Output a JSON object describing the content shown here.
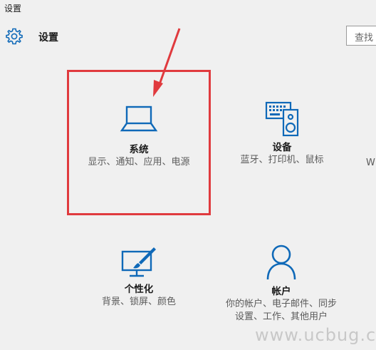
{
  "window": {
    "title": "设置"
  },
  "header": {
    "title": "设置",
    "search_placeholder": "查找"
  },
  "tiles": [
    {
      "id": "system",
      "title": "系统",
      "description": "显示、通知、应用、电源",
      "icon": "laptop-icon"
    },
    {
      "id": "devices",
      "title": "设备",
      "description": "蓝牙、打印机、鼠标",
      "icon": "keyboard-speaker-icon"
    },
    {
      "id": "personalization",
      "title": "个性化",
      "description": "背景、锁屏、颜色",
      "icon": "monitor-brush-icon"
    },
    {
      "id": "accounts",
      "title": "帐户",
      "description": "你的帐户、电子邮件、同步设置、工作、其他用户",
      "icon": "person-icon"
    }
  ],
  "edge_text": "W",
  "watermark": "www.ucbug.cc",
  "colors": {
    "background": "#f0f0f0",
    "accent": "#0f69b8",
    "annotation": "#e03a3e"
  }
}
